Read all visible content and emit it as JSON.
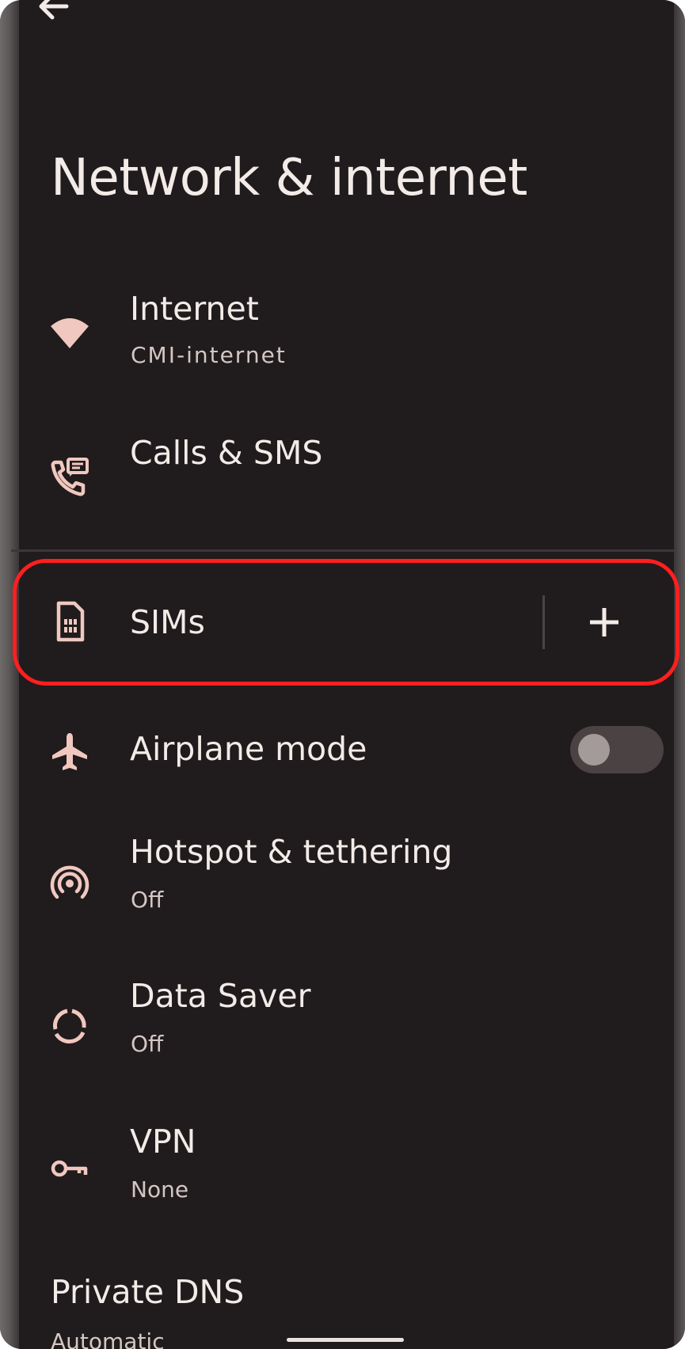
{
  "page": {
    "title": "Network & internet"
  },
  "colors": {
    "background": "#201b1c",
    "text_primary": "#f2ebe8",
    "text_secondary": "#d3c7c4",
    "icon_tint": "#f0c8c0",
    "highlight": "#ff1f1f"
  },
  "items": [
    {
      "id": "internet",
      "icon": "wifi-icon",
      "title": "Internet",
      "subtitle": "CMI-internet"
    },
    {
      "id": "calls-sms",
      "icon": "phone-message-icon",
      "title": "Calls & SMS"
    },
    {
      "id": "sims",
      "icon": "sim-card-icon",
      "title": "SIMs",
      "action_icon": "plus-icon"
    },
    {
      "id": "airplane",
      "icon": "airplane-icon",
      "title": "Airplane mode",
      "toggle_on": false
    },
    {
      "id": "hotspot",
      "icon": "hotspot-icon",
      "title": "Hotspot & tethering",
      "subtitle": "Off"
    },
    {
      "id": "data-saver",
      "icon": "data-saver-icon",
      "title": "Data Saver",
      "subtitle": "Off"
    },
    {
      "id": "vpn",
      "icon": "key-icon",
      "title": "VPN",
      "subtitle": "None"
    },
    {
      "id": "private-dns",
      "title": "Private DNS",
      "subtitle": "Automatic"
    }
  ]
}
